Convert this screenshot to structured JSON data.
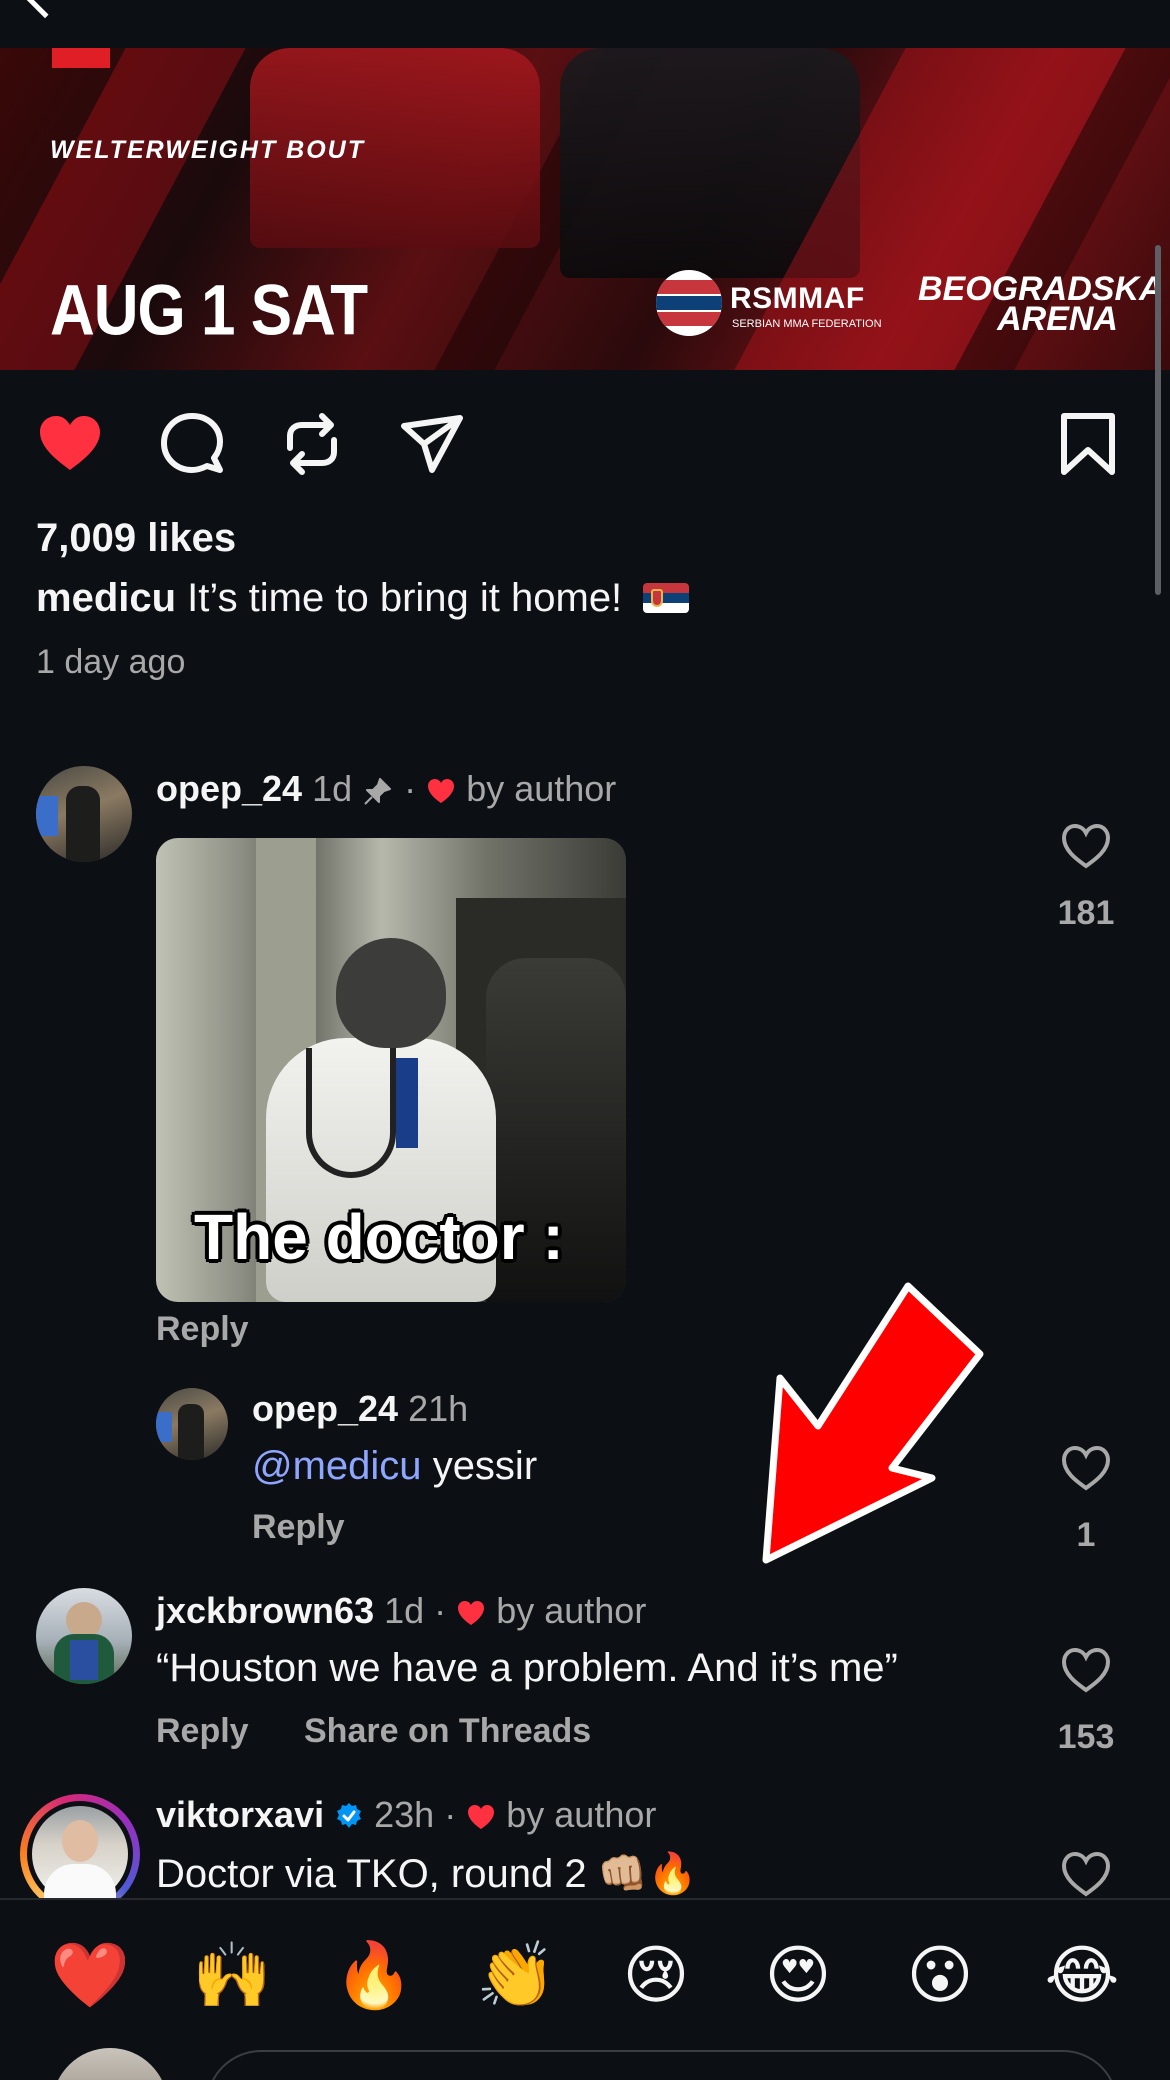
{
  "poster": {
    "bout_label": "WELTERWEIGHT BOUT",
    "date": "AUG 1 SAT",
    "federation_name": "RSMMAF",
    "federation_sub": "SERBIAN MMA FEDERATION",
    "arena_line1": "BEOGRADSKA",
    "arena_line2": "ARENA"
  },
  "post": {
    "likes": "7,009 likes",
    "caption_user": "medicu",
    "caption_text": "It’s time to bring it home!",
    "time_ago": "1 day ago",
    "liked": true
  },
  "comments": [
    {
      "user": "opep_24",
      "time": "1d",
      "pinned": true,
      "by_author": "by author",
      "gif_caption": "The doctor :",
      "reply_label": "Reply",
      "like_count": "181"
    },
    {
      "user": "opep_24",
      "time": "21h",
      "mention": "@medicu",
      "text": "yessir",
      "reply_label": "Reply",
      "like_count": "1"
    },
    {
      "user": "jxckbrown63",
      "time": "1d",
      "by_author": "by author",
      "text": "“Houston we have a problem. And it’s me”",
      "reply_label": "Reply",
      "share_label": "Share on Threads",
      "like_count": "153"
    },
    {
      "user": "viktorxavi",
      "verified": true,
      "time": "23h",
      "by_author": "by author",
      "text": "Doctor via TKO, round 2 👊🏼🔥"
    }
  ],
  "reactions": [
    "❤️",
    "🙌",
    "🔥",
    "👏",
    "😢",
    "😍",
    "😮",
    "😂"
  ],
  "colors": {
    "background": "#0c1014",
    "like_red": "#ff3040",
    "secondary_text": "#a8a8a8",
    "mention_blue": "#8ea6ff",
    "verified_blue": "#0095f6",
    "annotation_arrow": "#ff0000"
  },
  "icons": {
    "like": "heart-filled-icon",
    "comment": "comment-bubble-icon",
    "repost": "repost-icon",
    "share": "paper-plane-icon",
    "save": "bookmark-icon",
    "pin": "pin-icon",
    "verified": "verified-badge-icon"
  }
}
